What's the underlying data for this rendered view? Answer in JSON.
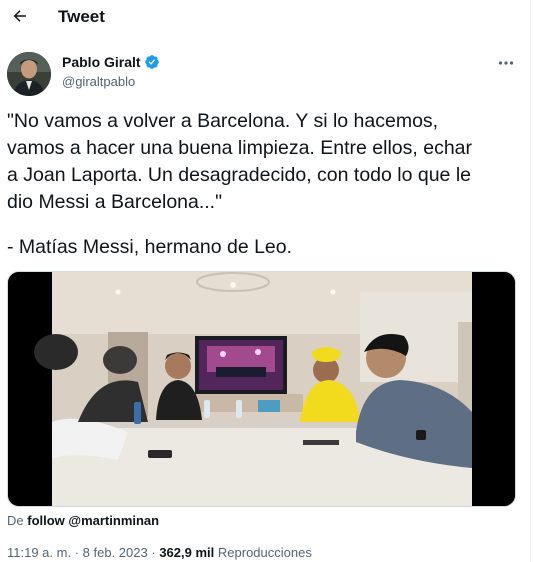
{
  "header": {
    "title": "Tweet",
    "back_icon": "arrow-left-icon"
  },
  "author": {
    "name": "Pablo Giralt",
    "handle": "@giraltpablo",
    "verified_icon": "verified-badge-icon",
    "verified_color": "#1d9bf0",
    "more_icon": "more-horizontal-icon"
  },
  "tweet": {
    "lines": [
      "\"No vamos a volver a Barcelona. Y si lo hacemos,",
      "vamos a hacer una buena limpieza. Entre ellos, echar",
      "a Joan Laporta. Un desagradecido, con todo lo que le",
      "dio Messi a Barcelona...\""
    ],
    "signature": "- Matías Messi, hermano de Leo."
  },
  "attribution": {
    "prefix": "De",
    "source": "follow @martinminan"
  },
  "meta": {
    "time": "11:19 a. m.",
    "separator_1": "·",
    "date": "8 feb. 2023",
    "separator_2": "·",
    "views_count": "362,9 mil",
    "views_label": "Reproducciones"
  }
}
